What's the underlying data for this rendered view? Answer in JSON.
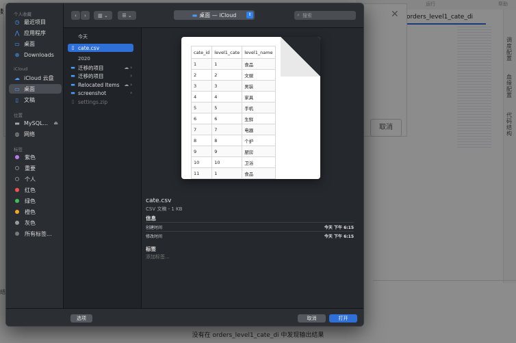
{
  "background": {
    "topbar_left": "运行",
    "topbar_right": "帮助",
    "editor_tab": "orders_level1_cate_di",
    "right_panel_labels": [
      "调度配置",
      "血缘配置",
      "代码结构"
    ],
    "modal_cut_label": "数",
    "cancel_label": "取消",
    "side_mark": "结",
    "bottom_message": "没有在 orders_level1_cate_di 中发现输出结果"
  },
  "sidebar": {
    "favorites_title": "个人收藏",
    "favorites": [
      {
        "label": "最近项目",
        "icon": "clock-icon"
      },
      {
        "label": "应用程序",
        "icon": "applications-icon"
      },
      {
        "label": "桌面",
        "icon": "desktop-icon"
      },
      {
        "label": "Downloads",
        "icon": "downloads-icon"
      }
    ],
    "icloud_title": "iCloud",
    "icloud": [
      {
        "label": "iCloud 云盘",
        "icon": "cloud-icon"
      },
      {
        "label": "桌面",
        "icon": "desktop-icon",
        "selected": true
      },
      {
        "label": "文稿",
        "icon": "document-icon"
      }
    ],
    "locations_title": "位置",
    "locations": [
      {
        "label": "MySQL...",
        "icon": "disk-icon"
      },
      {
        "label": "网络",
        "icon": "globe-icon"
      }
    ],
    "tags_title": "标签",
    "tags": [
      {
        "label": "紫色",
        "color": "#b77ce8"
      },
      {
        "label": "重要",
        "color": "transparent"
      },
      {
        "label": "个人",
        "color": "transparent"
      },
      {
        "label": "红色",
        "color": "#ef5350"
      },
      {
        "label": "绿色",
        "color": "#3fbf5a"
      },
      {
        "label": "橙色",
        "color": "#f5a623"
      },
      {
        "label": "灰色",
        "color": "#9a9a9a"
      },
      {
        "label": "所有标签...",
        "color": "#7a7a7a"
      }
    ]
  },
  "toolbar": {
    "back_icon": "‹",
    "forward_icon": "›",
    "view_icon": "columns-icon",
    "group_icon": "list-icon",
    "location": "桌面 — iCloud",
    "search_placeholder": "搜索"
  },
  "filelist": {
    "group_today": "今天",
    "today_items": [
      {
        "label": "cate.csv",
        "selected": true
      }
    ],
    "group_2020": "2020",
    "items_2020": [
      {
        "label": "迁移的项目",
        "folder": true,
        "cloud": true
      },
      {
        "label": "迁移的项目",
        "folder": true,
        "cloud": false
      },
      {
        "label": "Relocated Items",
        "folder": true,
        "cloud": true
      },
      {
        "label": "screenshot",
        "folder": true,
        "cloud": false
      },
      {
        "label": "settings.zip",
        "folder": false,
        "cloud": false,
        "dimmed": true
      }
    ]
  },
  "preview": {
    "columns": [
      "cate_id",
      "level1_cate",
      "level1_name"
    ],
    "rows": [
      [
        "1",
        "1",
        "食品"
      ],
      [
        "2",
        "2",
        "文娱"
      ],
      [
        "3",
        "3",
        "男装"
      ],
      [
        "4",
        "4",
        "家具"
      ],
      [
        "5",
        "5",
        "手机"
      ],
      [
        "6",
        "6",
        "生鲜"
      ],
      [
        "7",
        "7",
        "电器"
      ],
      [
        "8",
        "8",
        "个护"
      ],
      [
        "9",
        "9",
        "厨房"
      ],
      [
        "10",
        "10",
        "卫浴"
      ],
      [
        "11",
        "1",
        "食品"
      ]
    ],
    "file_name": "cate.csv",
    "file_kind": "CSV 文稿 - 1 KB",
    "info_title": "信息",
    "created_label": "创建时间",
    "created_value": "今天 下午 6:15",
    "modified_label": "修改时间",
    "modified_value": "今天 下午 6:15",
    "tags_title": "标签",
    "add_tags": "添加标签..."
  },
  "buttons": {
    "options": "选项",
    "cancel": "取消",
    "open": "打开"
  },
  "colors": {
    "accent": "#2e6fd8",
    "dialog_bg": "#1f2227"
  }
}
